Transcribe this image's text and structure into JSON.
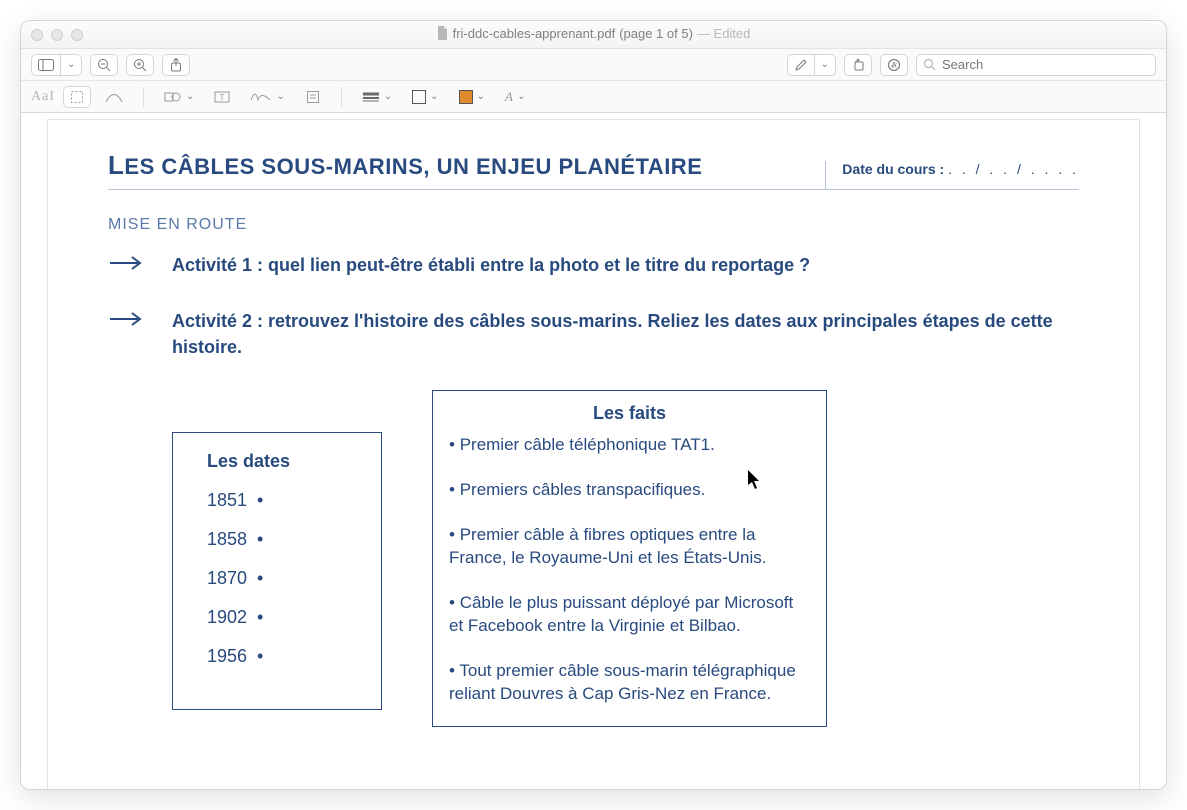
{
  "window": {
    "title_file": "fri-ddc-cables-apprenant.pdf",
    "title_pages": "(page 1 of 5)",
    "title_edited": "— Edited",
    "search_placeholder": "Search"
  },
  "document": {
    "title_pre": "L",
    "title_main": "ES CÂBLES SOUS-MARINS, UN ENJEU PLANÉTAIRE",
    "date_label": "Date du cours :",
    "date_dots": ". . / . . / . . . .",
    "section": "MISE EN ROUTE",
    "activity1": "Activité 1 : quel lien peut-être établi entre la photo et le titre du reportage ?",
    "activity2": "Activité 2 : retrouvez l'histoire des câbles sous-marins. Reliez les dates aux principales étapes de cette histoire.",
    "dates_title": "Les dates",
    "dates": [
      "1851",
      "1858",
      "1870",
      "1902",
      "1956"
    ],
    "faits_title": "Les faits",
    "faits": [
      "Premier câble téléphonique TAT1.",
      "Premiers câbles transpacifiques.",
      "Premier câble à fibres optiques entre la France, le Royaume-Uni et les États-Unis.",
      "Câble le plus puissant déployé par Microsoft et Facebook entre la Virginie et Bilbao.",
      "Tout premier câble sous-marin télégraphique reliant Douvres à Cap Gris-Nez en France."
    ]
  }
}
